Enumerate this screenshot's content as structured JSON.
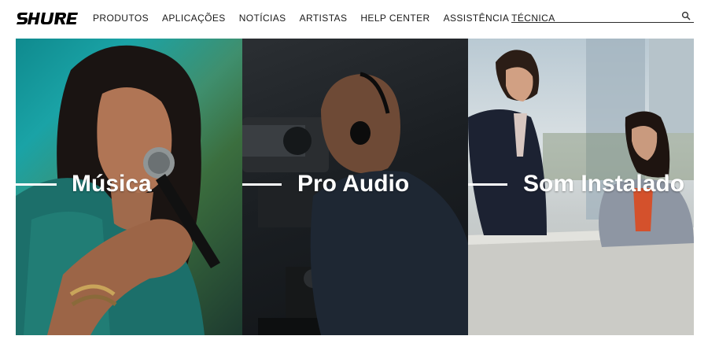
{
  "brand": {
    "logo_text": "SHURE"
  },
  "nav": {
    "items": [
      {
        "label": "PRODUTOS"
      },
      {
        "label": "APLICAÇÕES"
      },
      {
        "label": "NOTÍCIAS"
      },
      {
        "label": "ARTISTAS"
      },
      {
        "label": "HELP CENTER"
      },
      {
        "label": "ASSISTÊNCIA TÉCNICA"
      }
    ]
  },
  "search": {
    "value": "",
    "placeholder": "",
    "icon": "search-icon"
  },
  "panels": [
    {
      "title": "Música"
    },
    {
      "title": "Pro Audio"
    },
    {
      "title": "Som Instalado"
    }
  ],
  "colors": {
    "text": "#1a1a1a",
    "overlay_text": "#ffffff",
    "background": "#ffffff"
  }
}
